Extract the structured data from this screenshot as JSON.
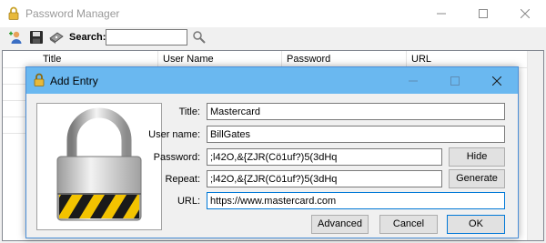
{
  "main_window": {
    "title": "Password Manager",
    "toolbar": {
      "search_label": "Search:",
      "search_value": ""
    },
    "table": {
      "columns": [
        "Title",
        "User Name",
        "Password",
        "URL"
      ]
    }
  },
  "dialog": {
    "title": "Add Entry",
    "fields": {
      "title_label": "Title:",
      "title_value": "Mastercard",
      "username_label": "User name:",
      "username_value": "BillGates",
      "password_label": "Password:",
      "password_value": ";l42O,&{ZJR(Cö1uf?)5(3dHq",
      "repeat_label": "Repeat:",
      "repeat_value": ";l42O,&{ZJR(Cö1uf?)5(3dHq",
      "url_label": "URL:",
      "url_value": "https://www.mastercard.com"
    },
    "buttons": {
      "hide": "Hide",
      "generate": "Generate",
      "advanced": "Advanced",
      "cancel": "Cancel",
      "ok": "OK"
    }
  }
}
